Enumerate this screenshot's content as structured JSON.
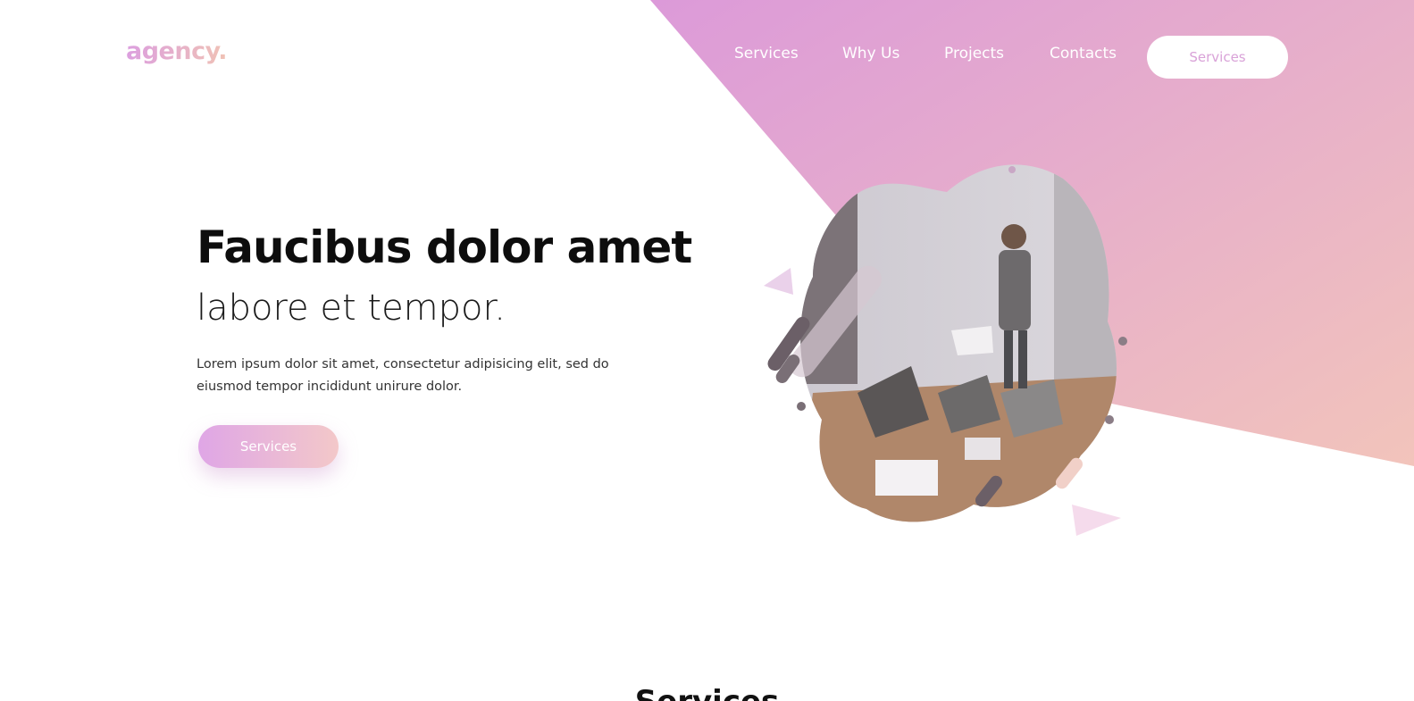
{
  "header": {
    "logo": "agency."
  },
  "nav": {
    "items": [
      {
        "label": "Services"
      },
      {
        "label": "Why Us"
      },
      {
        "label": "Projects"
      },
      {
        "label": "Contacts"
      }
    ],
    "cta_label": "Services"
  },
  "hero": {
    "title": "Faucibus dolor amet",
    "subtitle": "labore et tempor.",
    "description": "Lorem ipsum dolor sit amet, consectetur adipisicing elit, sed do eiusmod tempor incididunt unirure dolor.",
    "button_label": "Services"
  },
  "section": {
    "heading_peek": "Services"
  },
  "colors": {
    "gradient_start": "#dc9fdf",
    "gradient_end": "#f3c8c0",
    "cta_text": "#d9a2d8"
  },
  "icons": {
    "hero_image": "office-meeting-illustration"
  }
}
